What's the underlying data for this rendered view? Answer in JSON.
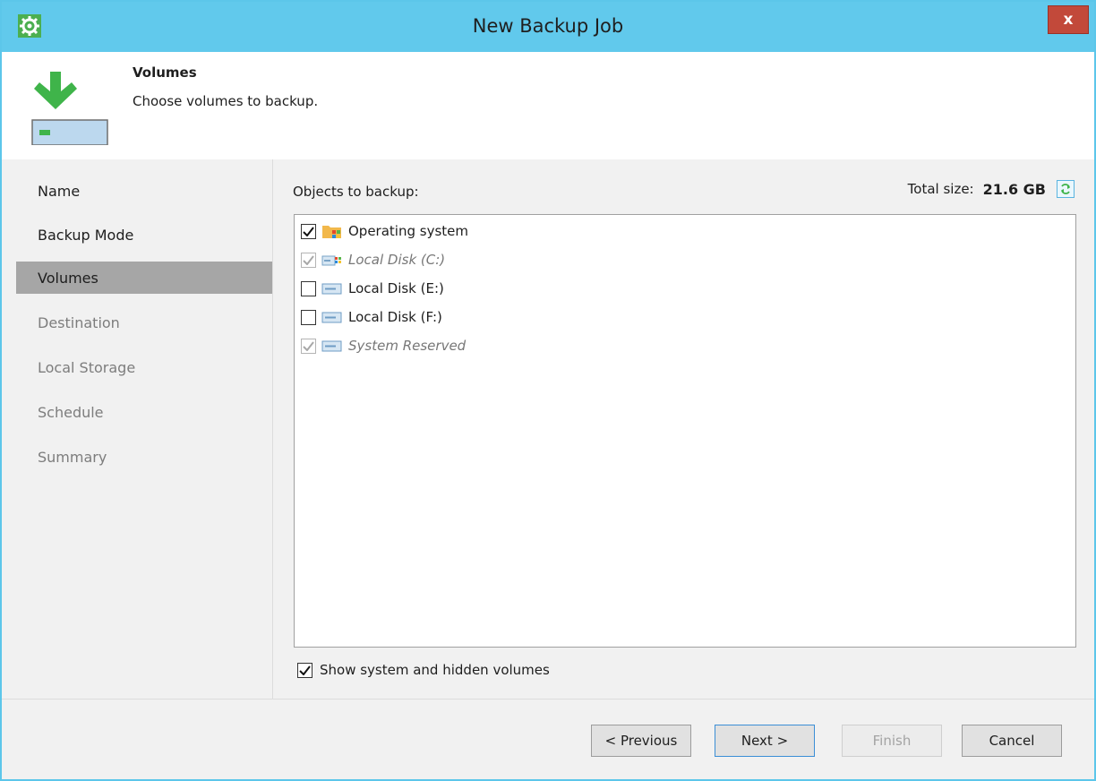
{
  "window": {
    "title": "New Backup Job",
    "close_label": "x"
  },
  "header": {
    "title": "Volumes",
    "subtitle": "Choose volumes to backup."
  },
  "sidebar": {
    "items": [
      {
        "label": "Name",
        "state": "done"
      },
      {
        "label": "Backup Mode",
        "state": "done"
      },
      {
        "label": "Volumes",
        "state": "active"
      },
      {
        "label": "Destination",
        "state": "disabled"
      },
      {
        "label": "Local Storage",
        "state": "disabled"
      },
      {
        "label": "Schedule",
        "state": "disabled"
      },
      {
        "label": "Summary",
        "state": "disabled"
      }
    ]
  },
  "main": {
    "objects_label": "Objects to backup:",
    "total_size_label": "Total size:",
    "total_size_value": "21.6 GB",
    "tree": [
      {
        "label": "Operating system",
        "checked": true,
        "enabled": true,
        "icon": "os-folder-icon"
      },
      {
        "label": "Local Disk (C:)",
        "checked": true,
        "enabled": false,
        "icon": "windows-drive-icon"
      },
      {
        "label": "Local Disk (E:)",
        "checked": false,
        "enabled": true,
        "icon": "drive-icon"
      },
      {
        "label": "Local Disk (F:)",
        "checked": false,
        "enabled": true,
        "icon": "drive-icon"
      },
      {
        "label": "System Reserved",
        "checked": true,
        "enabled": false,
        "icon": "drive-icon"
      }
    ],
    "show_hidden_label": "Show system and hidden volumes",
    "show_hidden_checked": true
  },
  "footer": {
    "previous_label": "< Previous",
    "next_label": "Next >",
    "finish_label": "Finish",
    "cancel_label": "Cancel"
  },
  "colors": {
    "titlebar": "#61c9ec",
    "active_nav": "#a6a6a6",
    "accent_green": "#3fb44a",
    "close_red": "#c2493a"
  }
}
